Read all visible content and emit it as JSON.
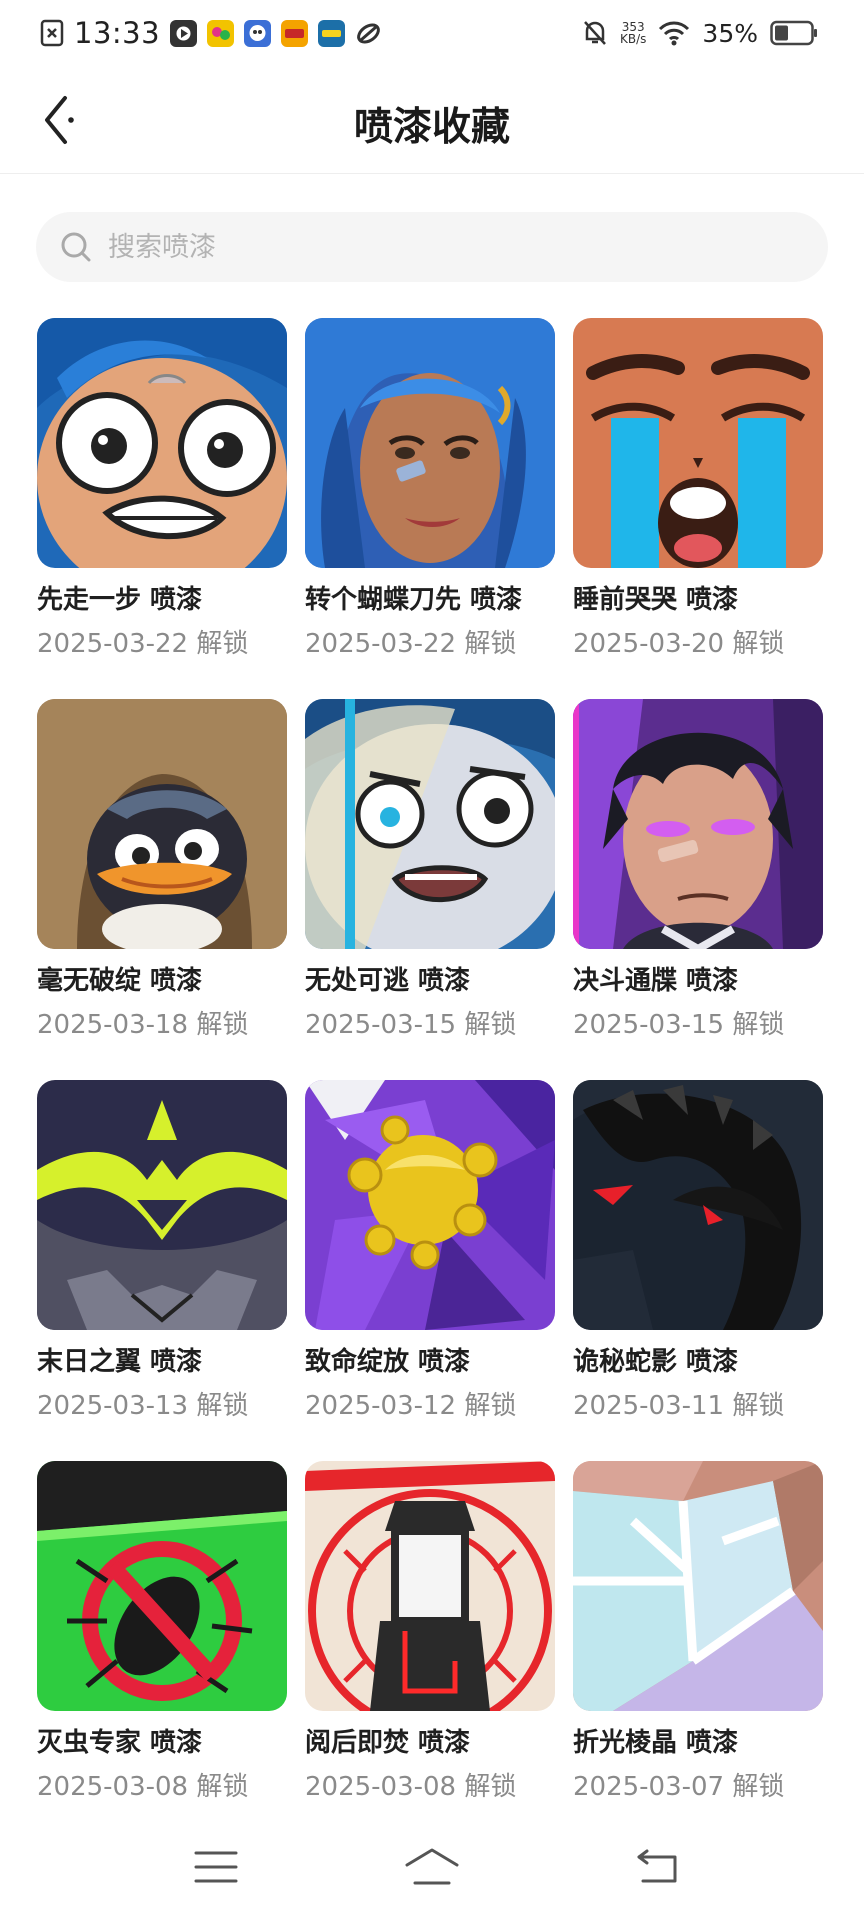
{
  "status_bar": {
    "time": "13:33",
    "net_speed_value": "353",
    "net_speed_unit": "KB/s",
    "battery_percent": "35%",
    "app_icons": [
      "#3a3a3a",
      "#f2c300",
      "#3b6fd6",
      "#f4a300",
      "#1c6fa8"
    ]
  },
  "header": {
    "title": "喷漆收藏",
    "back_icon": "chevron-left-icon"
  },
  "search": {
    "placeholder": "搜索喷漆",
    "value": ""
  },
  "sprays": [
    {
      "title": "先走一步 喷漆",
      "date": "2025-03-22 解锁"
    },
    {
      "title": "转个蝴蝶刀先 喷漆",
      "date": "2025-03-22 解锁"
    },
    {
      "title": "睡前哭哭 喷漆",
      "date": "2025-03-20 解锁"
    },
    {
      "title": "毫无破绽 喷漆",
      "date": "2025-03-18 解锁"
    },
    {
      "title": "无处可逃 喷漆",
      "date": "2025-03-15 解锁"
    },
    {
      "title": "决斗通牒 喷漆",
      "date": "2025-03-15 解锁"
    },
    {
      "title": "末日之翼 喷漆",
      "date": "2025-03-13 解锁"
    },
    {
      "title": "致命绽放 喷漆",
      "date": "2025-03-12 解锁"
    },
    {
      "title": "诡秘蛇影 喷漆",
      "date": "2025-03-11 解锁"
    },
    {
      "title": "灭虫专家 喷漆",
      "date": "2025-03-08 解锁"
    },
    {
      "title": "阅后即焚 喷漆",
      "date": "2025-03-08 解锁"
    },
    {
      "title": "折光棱晶 喷漆",
      "date": "2025-03-07 解锁"
    }
  ],
  "bottom_nav": {
    "icons": [
      "menu-icon",
      "home-icon",
      "back-icon"
    ]
  }
}
